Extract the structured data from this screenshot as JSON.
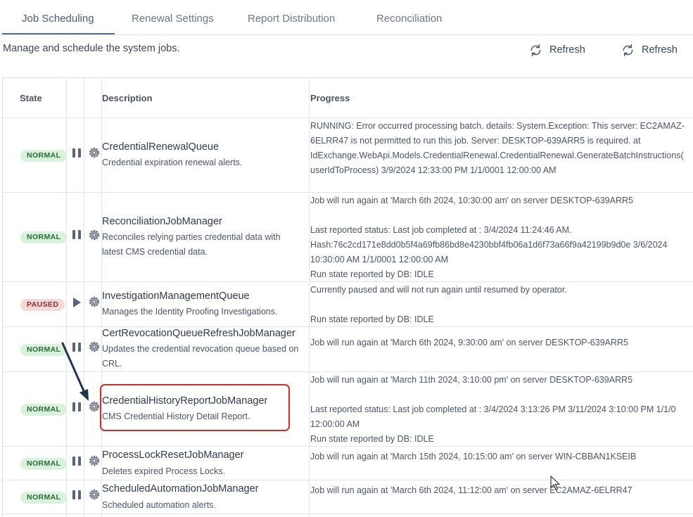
{
  "tabs": [
    {
      "label": "Job Scheduling",
      "active": true
    },
    {
      "label": "Renewal Settings"
    },
    {
      "label": "Report Distribution"
    },
    {
      "label": "Reconciliation"
    }
  ],
  "subtitle": "Manage and schedule the system jobs.",
  "refresh_buttons": [
    "Refresh",
    "Refresh"
  ],
  "columns": {
    "state": "State",
    "description": "Description",
    "progress": "Progress"
  },
  "jobs": [
    {
      "state": "NORMAL",
      "control": "pause",
      "name": "CredentialRenewalQueue",
      "description": "Credential expiration renewal alerts.",
      "progress": "RUNNING: Error occurred processing batch. details: System.Exception: This server: EC2AMAZ-\n6ELRR47 is not permitted to run this job. Server: DESKTOP-639ARR5 is required. at\nIdExchange.WebApi.Models.CredentialRenewal.CredentialRenewal.GenerateBatchInstructions(\nuserIdToProcess) 3/9/2024 12:33:00 PM 1/1/0001 12:00:00 AM"
    },
    {
      "state": "NORMAL",
      "control": "pause",
      "name": "ReconciliationJobManager",
      "description": "Reconciles relying parties credential data with\nlatest CMS credential data.",
      "progress": "Job will run again at 'March 6th 2024, 10:30:00 am' on server DESKTOP-639ARR5\n\nLast reported status: Last job completed at : 3/4/2024 11:24:46 AM.\nHash:76c2cd171e8dd0b5f4a69fb86bd8e4230bbf4fb06a1d6f73a66f9a42199b9d0e 3/6/2024\n10:30:00 AM 1/1/0001 12:00:00 AM\nRun state reported by DB: IDLE"
    },
    {
      "state": "PAUSED",
      "control": "play",
      "name": "InvestigationManagementQueue",
      "description": "Manages the Identity Proofing Investigations.",
      "progress": "Currently paused and will not run again until resumed by operator.\n\nRun state reported by DB: IDLE"
    },
    {
      "state": "NORMAL",
      "control": "pause",
      "name": "CertRevocationQueueRefreshJobManager",
      "description": "Updates the credential revocation queue based on\nCRL.",
      "progress": "Job will run again at 'March 6th 2024, 9:30:00 am' on server DESKTOP-639ARR5"
    },
    {
      "state": "NORMAL",
      "control": "pause",
      "name": "CredentialHistoryReportJobManager",
      "description": "CMS Credential History Detail Report.",
      "progress": "Job will run again at 'March 11th 2024, 3:10:00 pm' on server DESKTOP-639ARR5\n\nLast reported status: Last job completed at : 3/4/2024 3:13:26 PM 3/11/2024 3:10:00 PM 1/1/0\n12:00:00 AM\nRun state reported by DB: IDLE"
    },
    {
      "state": "NORMAL",
      "control": "pause",
      "name": "ProcessLockResetJobManager",
      "description": "Deletes expired Process Locks.",
      "progress": "Job will run again at 'March 15th 2024, 10:15:00 am' on server WIN-CBBAN1KSEIB"
    },
    {
      "state": "NORMAL",
      "control": "pause",
      "name": "ScheduledAutomationJobManager",
      "description": "Scheduled automation alerts.",
      "progress": "Job will run again at 'March 6th 2024, 11:12:00 am' on server EC2AMAZ-6ELRR47"
    }
  ],
  "colors": {
    "accent": "#4d6fa8",
    "normal_bg": "#d9f2dc",
    "paused_bg": "#f8d7d7",
    "highlight": "#d62b2b"
  }
}
